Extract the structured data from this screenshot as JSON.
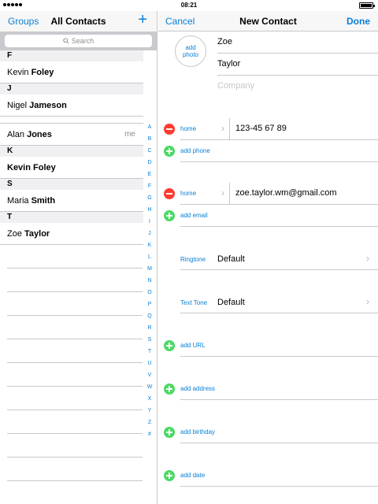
{
  "status_bar": {
    "time": "08:21"
  },
  "contacts_panel": {
    "groups_label": "Groups",
    "title": "All Contacts",
    "add_label": "+",
    "search_placeholder": "Search",
    "sections": [
      {
        "letter": "F",
        "contacts": [
          {
            "first": "Kevin",
            "last": "Foley"
          }
        ]
      },
      {
        "letter": "J",
        "contacts": [
          {
            "first": "Nigel",
            "last": "Jameson"
          }
        ]
      },
      {
        "letter": "",
        "contacts": [
          {
            "first": "Alan",
            "last": "Jones",
            "badge": "me"
          }
        ]
      },
      {
        "letter": "K",
        "contacts": [
          {
            "first": "",
            "last": "Kevin Foley"
          }
        ]
      },
      {
        "letter": "S",
        "contacts": [
          {
            "first": "Maria",
            "last": "Smith"
          }
        ]
      },
      {
        "letter": "T",
        "contacts": [
          {
            "first": "Zoe",
            "last": "Taylor"
          }
        ]
      }
    ],
    "index_letters": [
      "A",
      "B",
      "C",
      "D",
      "E",
      "F",
      "G",
      "H",
      "I",
      "J",
      "K",
      "L",
      "M",
      "N",
      "O",
      "P",
      "Q",
      "R",
      "S",
      "T",
      "U",
      "V",
      "W",
      "X",
      "Y",
      "Z",
      "#"
    ]
  },
  "new_contact": {
    "cancel_label": "Cancel",
    "title": "New Contact",
    "done_label": "Done",
    "add_photo_label_1": "add",
    "add_photo_label_2": "photo",
    "first_name": "Zoe",
    "last_name": "Taylor",
    "company_placeholder": "Company",
    "phone_type": "home",
    "phone_value": "123-45 67 89",
    "add_phone_label": "add phone",
    "email_type": "home",
    "email_value": "zoe.taylor.wm@gmail.com",
    "add_email_label": "add email",
    "ringtone_label": "Ringtone",
    "ringtone_value": "Default",
    "text_tone_label": "Text Tone",
    "text_tone_value": "Default",
    "add_url_label": "add URL",
    "add_address_label": "add address",
    "add_birthday_label": "add birthday",
    "add_date_label": "add date"
  },
  "colors": {
    "accent": "#0a7fd4",
    "delete": "#ff3b30",
    "add": "#4cd964",
    "separator": "#c8c7cc"
  }
}
